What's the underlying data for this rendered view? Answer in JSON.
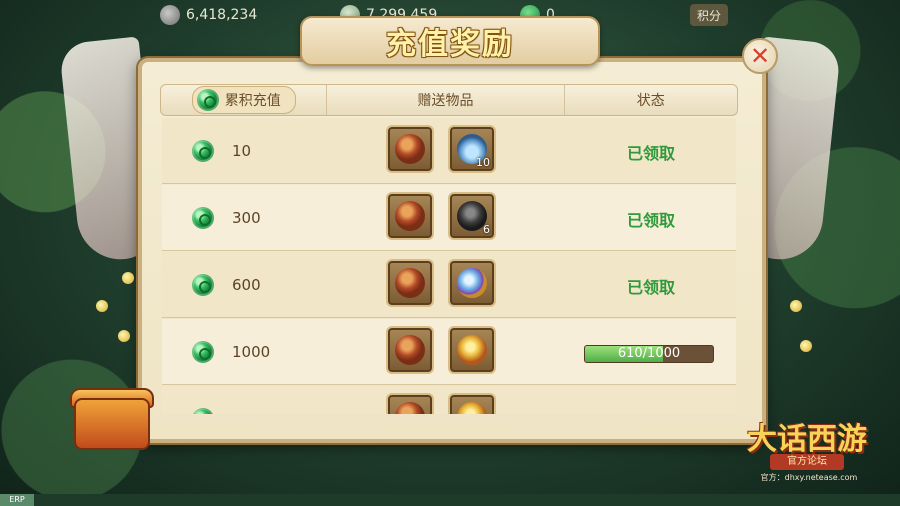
{
  "top_bar": {
    "silver_amount": "6,418,234",
    "silver_icon": "silver-coin-icon",
    "second_amount": "7,299,459",
    "second_icon": "silver-ingot-icon",
    "jade_amount": "0",
    "jade_icon": "jade-icon",
    "right_button_label": "积分"
  },
  "dialog": {
    "title": "充值奖励",
    "close_icon": "close-icon",
    "columns": {
      "cumulative": "累积充值",
      "gift_items": "赠送物品",
      "status": "状态"
    },
    "rows": [
      {
        "amount": "10",
        "items": [
          {
            "icon": "treasure-bag-icon",
            "count": ""
          },
          {
            "icon": "jade-vase-icon",
            "count": "10"
          }
        ],
        "status": "已领取"
      },
      {
        "amount": "300",
        "items": [
          {
            "icon": "treasure-bag-icon",
            "count": ""
          },
          {
            "icon": "dark-stone-icon",
            "count": "6"
          }
        ],
        "status": "已领取"
      },
      {
        "amount": "600",
        "items": [
          {
            "icon": "treasure-bag-icon",
            "count": ""
          },
          {
            "icon": "crystal-orb-icon",
            "count": ""
          }
        ],
        "status": "已领取"
      },
      {
        "amount": "1000",
        "items": [
          {
            "icon": "treasure-bag-icon",
            "count": ""
          },
          {
            "icon": "gold-pouch-icon",
            "count": ""
          }
        ],
        "progress_text": "610/1000",
        "progress_fraction": 0.61
      }
    ],
    "status_color": "#2f9a3b"
  },
  "logo": {
    "title": "大话西游",
    "subtitle": "官方论坛",
    "url": "官方：dhxy.netease.com"
  },
  "bottom_tag": "ERP"
}
